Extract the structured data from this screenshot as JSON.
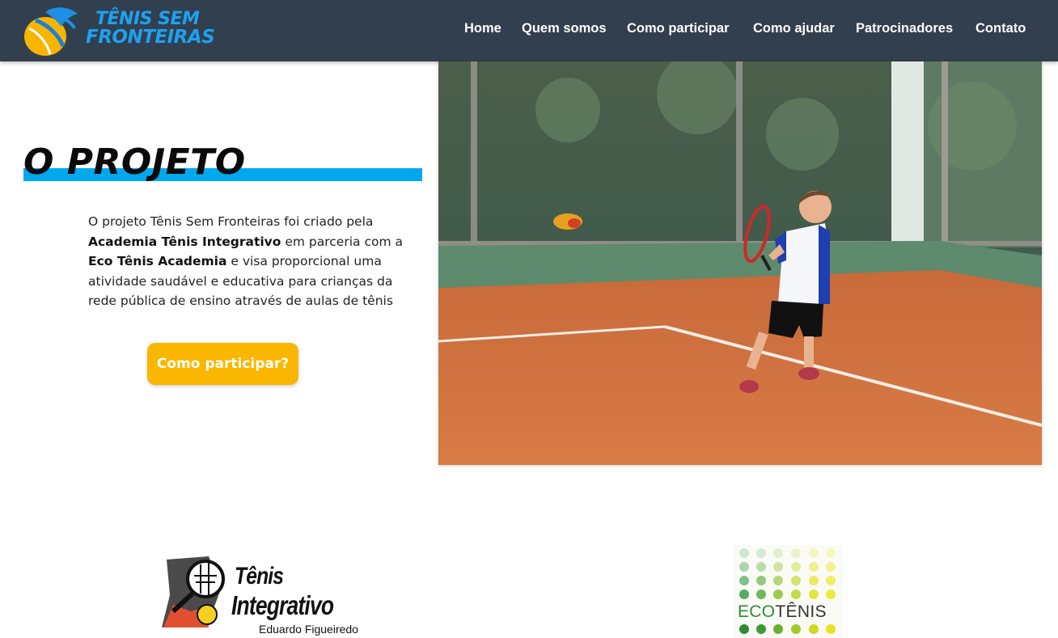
{
  "navbar": {
    "logo": {
      "line1": "TÊNIS SEM",
      "line2": "FRONTEIRAS"
    },
    "links": [
      {
        "label": "Home"
      },
      {
        "label": "Quem somos"
      },
      {
        "label": "Como participar"
      },
      {
        "label": "Como ajudar"
      },
      {
        "label": "Patrocinadores"
      },
      {
        "label": "Contato"
      }
    ]
  },
  "hero": {
    "title": "O PROJETO",
    "paragraph": {
      "part1": "O projeto Tênis Sem Fronteiras foi criado pela ",
      "bold1": "Academia Tênis Integrativo",
      "part2": " em parceria com a ",
      "bold2": "Eco Tênis Academia",
      "part3": " e visa proporcional uma atividade saudável e educativa para crianças da rede pública de ensino através de aulas de tênis"
    },
    "cta_label": "Como participar?"
  },
  "partners": {
    "tenis_integrativo": {
      "line1": "Tênis",
      "line2": "Integrativo",
      "line3": "Eduardo Figueiredo"
    },
    "ecotenis": {
      "eco": "ECO",
      "tenis": "TÊNIS"
    }
  },
  "colors": {
    "navbar_bg": "#323f4e",
    "accent_blue": "#00a8f0",
    "cta_yellow": "#fbb600"
  }
}
